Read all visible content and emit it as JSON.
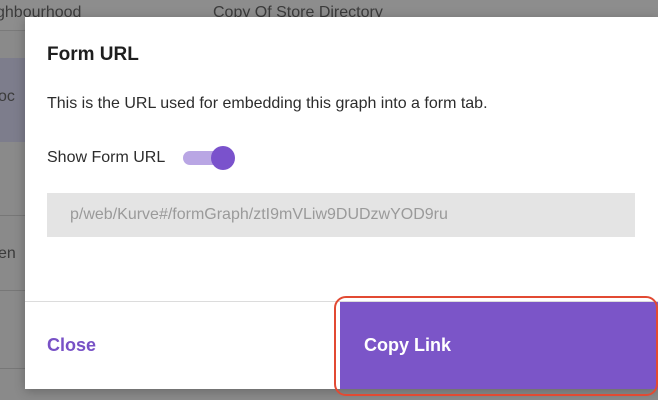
{
  "background": {
    "texts": [
      "ghbourhood",
      "Copy Of Store Directory",
      "oc",
      "en"
    ]
  },
  "modal": {
    "title": "Form URL",
    "description": "This is the URL used for embedding this graph into a form tab.",
    "toggle": {
      "label": "Show Form URL",
      "on": true
    },
    "url_value": "p/web/Kurve#/formGraph/ztI9mVLiw9DUDzwYOD9ru",
    "close_label": "Close",
    "copy_label": "Copy Link"
  },
  "colors": {
    "accent": "#7b55c8",
    "toggle_track": "#b9a6e4",
    "highlight": "#e24a33"
  }
}
